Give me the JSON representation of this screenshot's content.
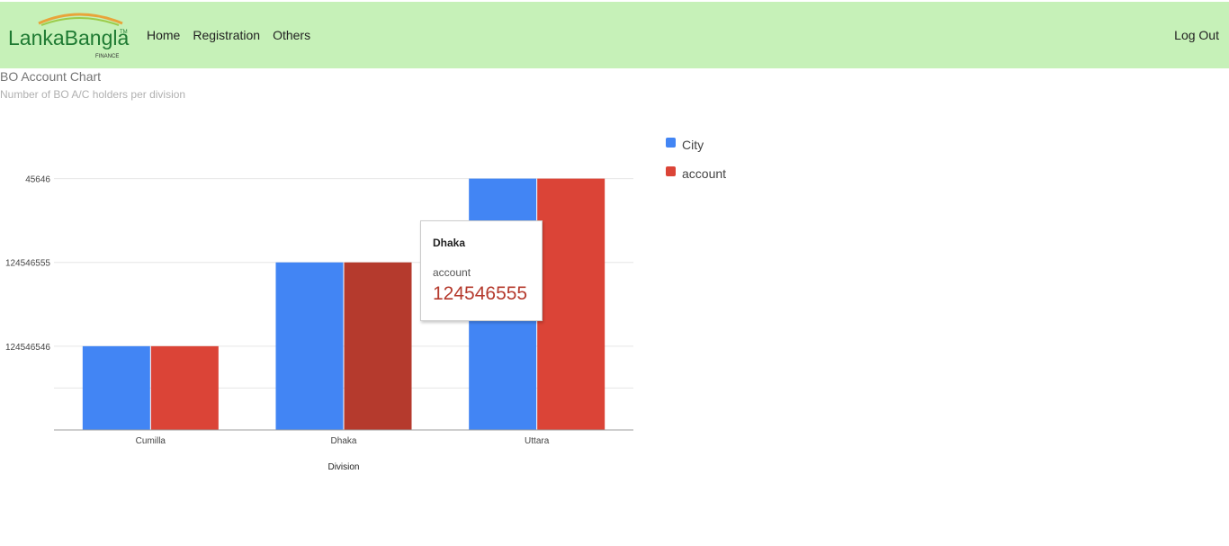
{
  "brand": {
    "name": "LankaBangla",
    "trademark": "TM",
    "tagline": "FINANCE"
  },
  "nav": {
    "items": [
      {
        "label": "Home"
      },
      {
        "label": "Registration"
      },
      {
        "label": "Others"
      }
    ],
    "logout_label": "Log Out"
  },
  "page": {
    "title": "BO Account Chart",
    "subtitle": "Number of BO A/C holders per division"
  },
  "colors": {
    "navbar": "#c6f1b8",
    "city": "#4285f4",
    "account": "#db4437",
    "account_highlight": "#b53a2d"
  },
  "chart_data": {
    "type": "bar",
    "title": "BO Account Chart",
    "subtitle": "Number of BO A/C holders per division",
    "xlabel": "Division",
    "ylabel": "",
    "categories": [
      "Cumilla",
      "Dhaka",
      "Uttara"
    ],
    "y_ticks": [
      "124546546",
      "124546555",
      "45646"
    ],
    "series": [
      {
        "name": "City",
        "values": [
          124546546,
          124546555,
          45646
        ]
      },
      {
        "name": "account",
        "values": [
          124546546,
          124546555,
          45646
        ]
      }
    ],
    "value_rank": [
      1,
      2,
      3
    ],
    "rank_max": 3.5,
    "grid": true,
    "legend": "right",
    "highlight": {
      "series": 1,
      "category": 1
    }
  },
  "tooltip": {
    "category": "Dhaka",
    "series": "account",
    "value": "124546555"
  }
}
